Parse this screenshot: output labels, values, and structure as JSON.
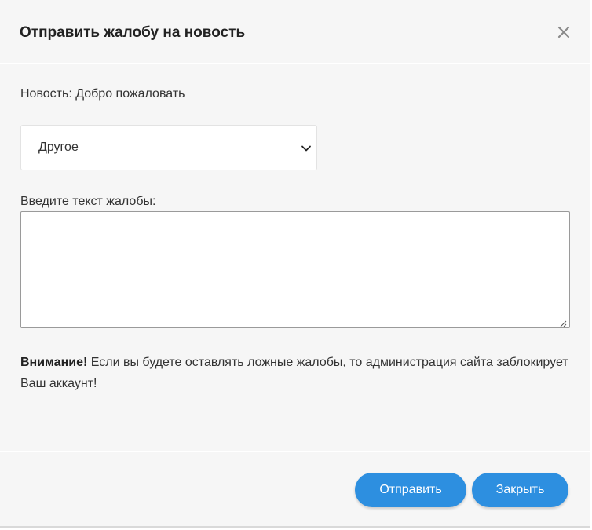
{
  "dialog": {
    "title": "Отправить жалобу на новость",
    "news_line": "Новость: Добро пожаловать",
    "select": {
      "selected": "Другое"
    },
    "textarea": {
      "label": "Введите текст жалобы:",
      "value": ""
    },
    "warning": {
      "bold": "Внимание!",
      "text": " Если вы будете оставлять ложные жалобы, то администрация сайта заблокирует Ваш аккаунт!"
    },
    "buttons": {
      "send": "Отправить",
      "close": "Закрыть"
    },
    "colors": {
      "button": "#2d8fe0",
      "background": "#f6f6f6"
    },
    "icons": {
      "close": "close-icon",
      "chevron": "chevron-down-icon",
      "resize": "resize-grip-icon"
    }
  }
}
